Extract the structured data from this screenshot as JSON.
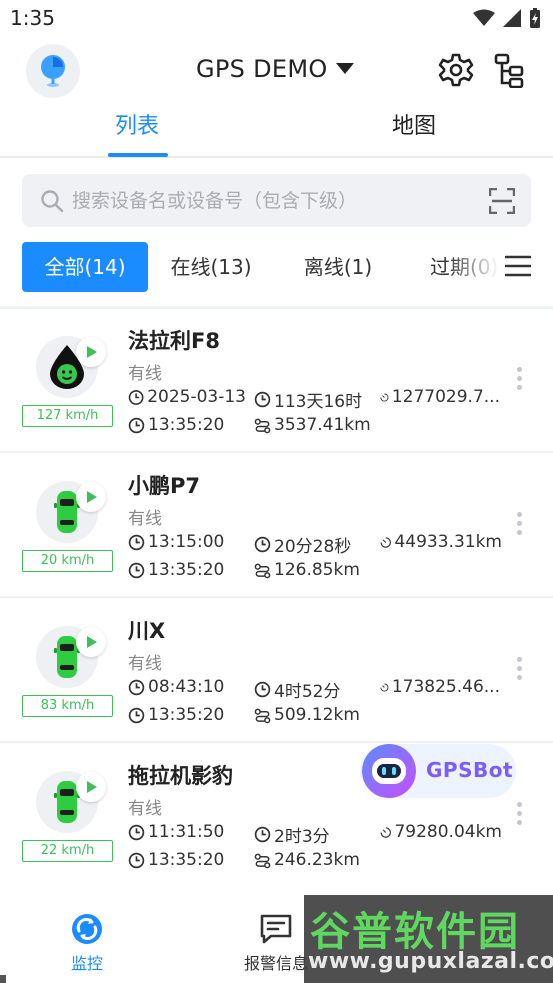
{
  "status_bar": {
    "time": "1:35"
  },
  "header": {
    "title": "GPS DEMO"
  },
  "tabs": [
    {
      "label": "列表"
    },
    {
      "label": "地图"
    }
  ],
  "search": {
    "placeholder": "搜索设备名或设备号（包含下级）"
  },
  "filters": [
    {
      "label": "全部(14)"
    },
    {
      "label": "在线(13)"
    },
    {
      "label": "离线(1)"
    },
    {
      "label": "过期(0)"
    }
  ],
  "vehicles": [
    {
      "name": "法拉利F8",
      "status": "有线",
      "speed": "127 km/h",
      "date": "2025-03-13",
      "duration": "113天16时",
      "mileage": "1277029.7...",
      "time": "13:35:20",
      "distance": "3537.41km",
      "icon": "droplet-face-icon"
    },
    {
      "name": "小鹏P7",
      "status": "有线",
      "speed": "20 km/h",
      "date": "13:15:00",
      "duration": "20分28秒",
      "mileage": "44933.31km",
      "time": "13:35:20",
      "distance": "126.85km",
      "icon": "car-icon"
    },
    {
      "name": "川X",
      "status": "有线",
      "speed": "83 km/h",
      "date": "08:43:10",
      "duration": "4时52分",
      "mileage": "173825.46...",
      "time": "13:35:20",
      "distance": "509.12km",
      "icon": "car-icon"
    },
    {
      "name": "拖拉机影豹",
      "status": "有线",
      "speed": "22 km/h",
      "date": "11:31:50",
      "duration": "2时3分",
      "mileage": "79280.04km",
      "time": "13:35:20",
      "distance": "246.23km",
      "icon": "car-icon"
    }
  ],
  "gpsbot": {
    "label": "GPSBot"
  },
  "bottom_nav": [
    {
      "label": "监控"
    },
    {
      "label": "报警信息"
    }
  ],
  "watermark": {
    "title": "谷普软件园",
    "url": "www.gupuxlazal.com"
  },
  "colors": {
    "accent": "#1a8cff",
    "speed_green": "#3fbf5b",
    "car_green": "#2ecc40"
  }
}
